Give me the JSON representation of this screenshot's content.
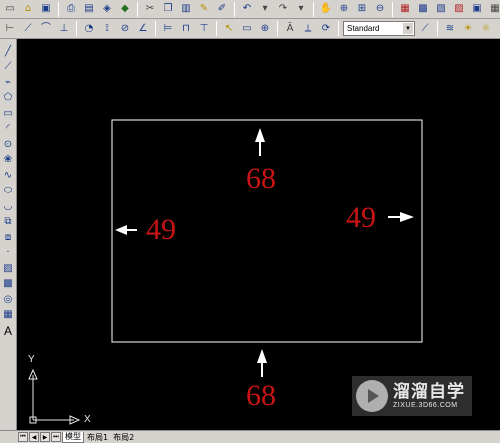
{
  "toolbar_top": {
    "style_value": "Standard",
    "help_glyph": "?"
  },
  "canvas": {
    "dimensions": {
      "top": "68",
      "bottom": "68",
      "left": "49",
      "right": "49"
    },
    "ucs": {
      "y_label": "Y",
      "x_label": "X"
    }
  },
  "tabs": [
    {
      "label": "模型",
      "active": true
    },
    {
      "label": "布局1",
      "active": false
    },
    {
      "label": "布局2",
      "active": false
    }
  ],
  "watermark": {
    "title": "溜溜自学",
    "url": "ZIXUE.3D66.COM"
  },
  "colors": {
    "dimension_text": "#c81414",
    "geometry": "#ffffff",
    "background": "#000000",
    "toolbar": "#d6d3ce"
  }
}
